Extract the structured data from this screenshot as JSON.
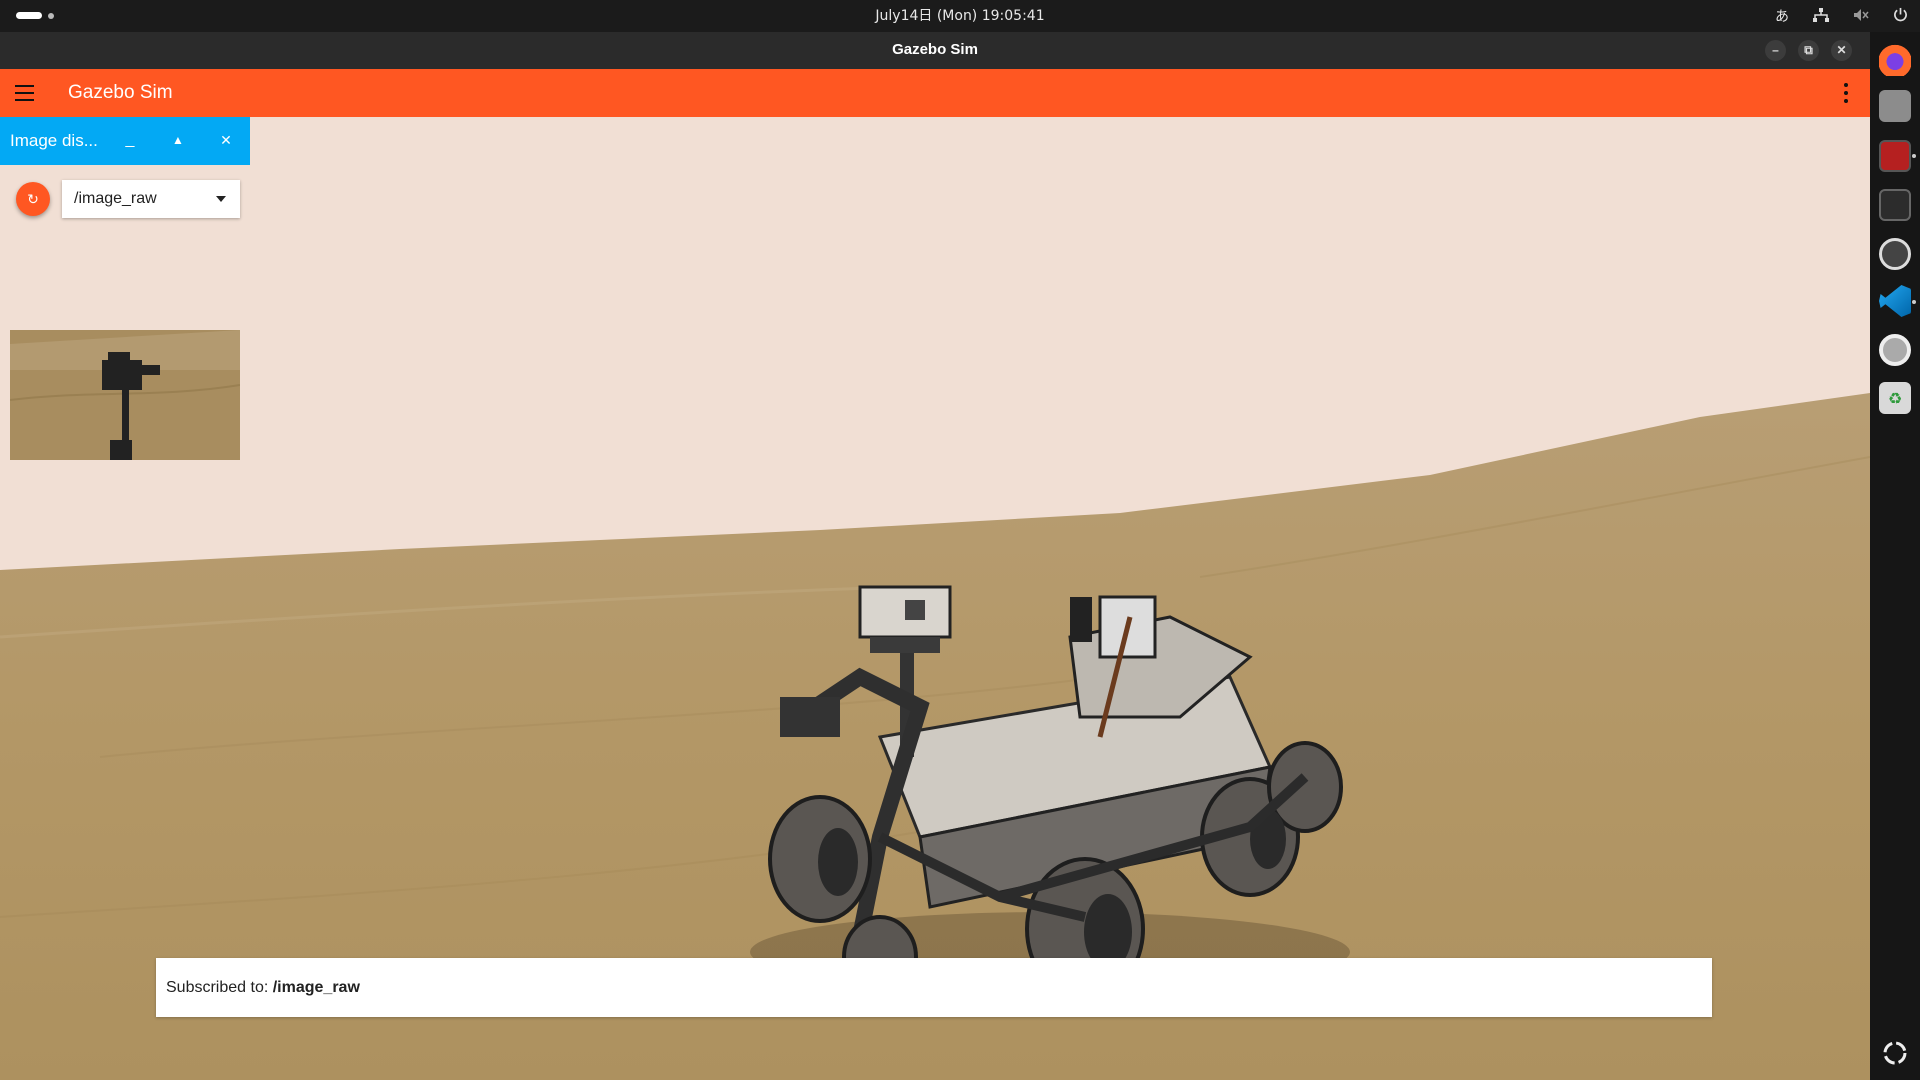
{
  "system": {
    "clock": "July14日 (Mon)  19:05:41",
    "input_method": "あ"
  },
  "window": {
    "title": "Gazebo Sim",
    "minimize": "–",
    "maximize": "⧉",
    "close": "✕"
  },
  "appbar": {
    "title": "Gazebo Sim"
  },
  "plugin": {
    "title": "Image dis...",
    "minimize": "_",
    "collapse": "▲",
    "close": "✕",
    "refresh": "↻",
    "topic": "/image_raw"
  },
  "status": {
    "prefix": "Subscribed to: ",
    "topic": "/image_raw"
  },
  "dock": {
    "apps": [
      "firefox",
      "files",
      "terminal-app",
      "system-monitor",
      "settings-disc",
      "vscode",
      "gazebo-settings",
      "trash"
    ]
  }
}
